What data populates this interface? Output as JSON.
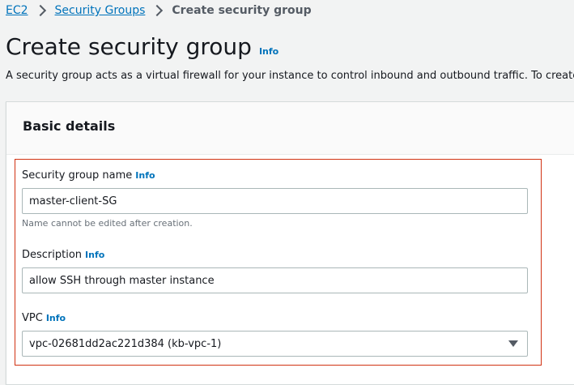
{
  "breadcrumb": {
    "items": [
      "EC2",
      "Security Groups"
    ],
    "current": "Create security group"
  },
  "page": {
    "title": "Create security group",
    "info": "Info",
    "description": "A security group acts as a virtual firewall for your instance to control inbound and outbound traffic. To create a"
  },
  "basic_details": {
    "title": "Basic details",
    "name_field": {
      "label": "Security group name",
      "info": "Info",
      "value": "master-client-SG",
      "hint": "Name cannot be edited after creation."
    },
    "description_field": {
      "label": "Description",
      "info": "Info",
      "value": "allow SSH through master instance"
    },
    "vpc_field": {
      "label": "VPC",
      "info": "Info",
      "value": "vpc-02681dd2ac221d384 (kb-vpc-1)"
    }
  },
  "colors": {
    "link": "#0073bb",
    "highlight_border": "#d13212",
    "background": "#f2f3f3"
  }
}
